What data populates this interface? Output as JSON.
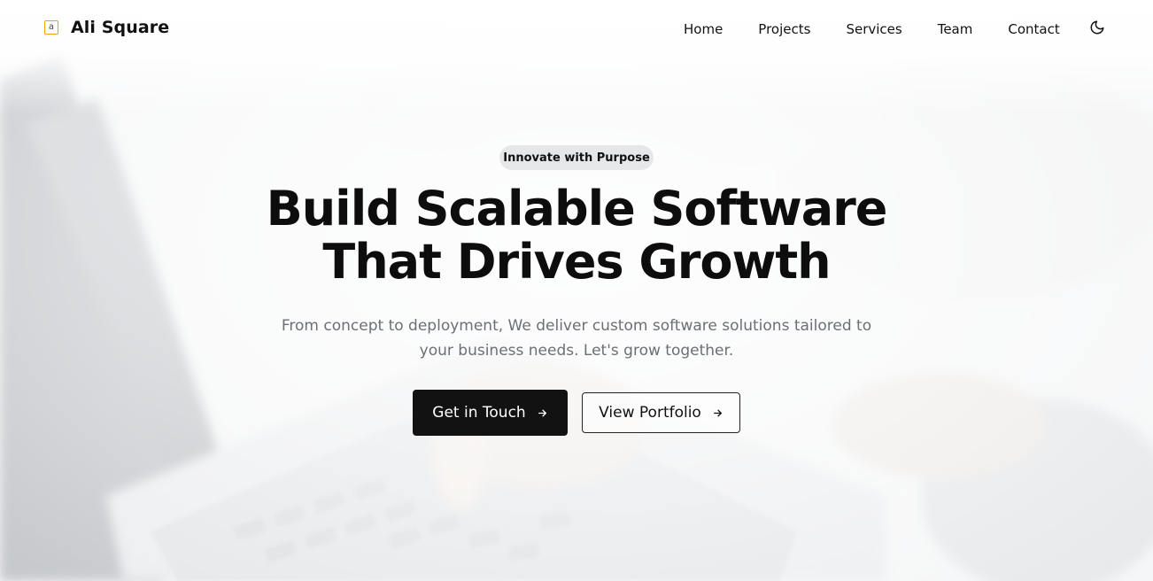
{
  "brand": {
    "logo_glyph": "a",
    "name": "Ali Square",
    "logo_color": "#e8a500"
  },
  "nav": {
    "items": [
      {
        "label": "Home"
      },
      {
        "label": "Projects"
      },
      {
        "label": "Services"
      },
      {
        "label": "Team"
      },
      {
        "label": "Contact"
      }
    ],
    "theme_icon": "moon-icon"
  },
  "hero": {
    "badge": "Innovate with Purpose",
    "headline_line1": "Build Scalable Software",
    "headline_line2": "That Drives Growth",
    "subtext": "From concept to deployment, We deliver custom software solutions tailored to your business needs. Let's grow together.",
    "primary_button": {
      "label": "Get in Touch",
      "icon": "arrow-right-icon"
    },
    "secondary_button": {
      "label": "View Portfolio",
      "icon": "arrow-right-icon"
    }
  },
  "colors": {
    "text": "#111111",
    "muted": "#6b6f76",
    "primary_button_bg": "#121212",
    "badge_bg": "#e6e7e9"
  }
}
